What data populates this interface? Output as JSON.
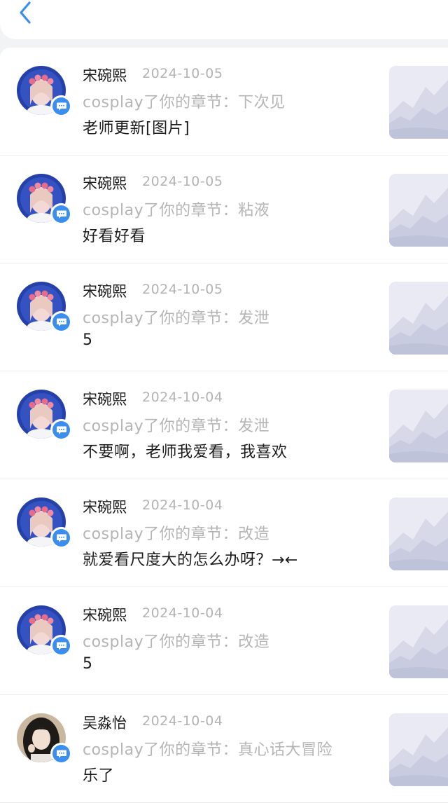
{
  "nav": {
    "back_icon": "chevron-left-icon",
    "accent": "#3a8ef0"
  },
  "items": [
    {
      "name": "宋碗熙",
      "date": "2024-10-05",
      "action": "cosplay了你的章节：下次见",
      "comment": "老师更新[图片]",
      "avatar": "pink-flower-girl"
    },
    {
      "name": "宋碗熙",
      "date": "2024-10-05",
      "action": "cosplay了你的章节：粘液",
      "comment": "好看好看",
      "avatar": "pink-flower-girl"
    },
    {
      "name": "宋碗熙",
      "date": "2024-10-05",
      "action": "cosplay了你的章节：发泄",
      "comment": "5",
      "avatar": "pink-flower-girl"
    },
    {
      "name": "宋碗熙",
      "date": "2024-10-04",
      "action": "cosplay了你的章节：发泄",
      "comment": "不要啊，老师我爱看，我喜欢",
      "avatar": "pink-flower-girl"
    },
    {
      "name": "宋碗熙",
      "date": "2024-10-04",
      "action": "cosplay了你的章节：改造",
      "comment": "就爱看尺度大的怎么办呀？→←",
      "avatar": "pink-flower-girl"
    },
    {
      "name": "宋碗熙",
      "date": "2024-10-04",
      "action": "cosplay了你的章节：改造",
      "comment": "5",
      "avatar": "pink-flower-girl"
    },
    {
      "name": "吴淼怡",
      "date": "2024-10-04",
      "action": "cosplay了你的章节：真心话大冒险",
      "comment": "乐了",
      "avatar": "dark-hair-girl"
    }
  ]
}
